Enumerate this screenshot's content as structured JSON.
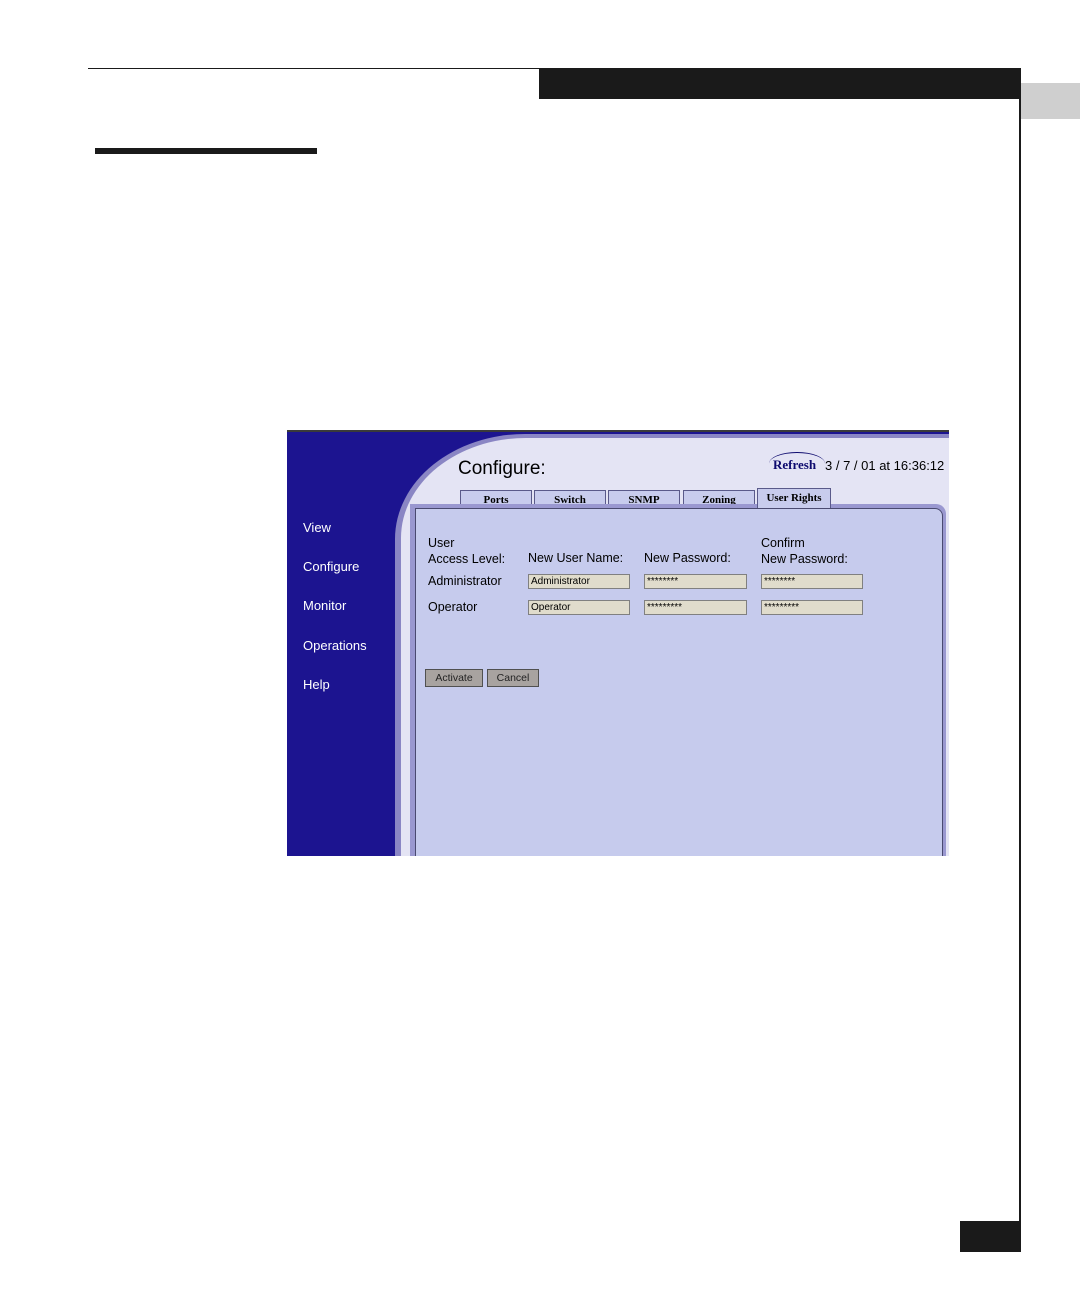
{
  "app": {
    "title": "Configure:",
    "refresh_label": "Refresh",
    "timestamp": "3 / 7 / 01 at 16:36:12"
  },
  "nav": {
    "items": [
      {
        "label": "View"
      },
      {
        "label": "Configure"
      },
      {
        "label": "Monitor"
      },
      {
        "label": "Operations"
      },
      {
        "label": "Help"
      }
    ]
  },
  "tabs": [
    {
      "label": "Ports"
    },
    {
      "label": "Switch"
    },
    {
      "label": "SNMP"
    },
    {
      "label": "Zoning"
    },
    {
      "label": "User Rights",
      "active": true
    }
  ],
  "form": {
    "headers": {
      "access_level": "User\nAccess Level:",
      "new_user_name": "New User Name:",
      "new_password": "New Password:",
      "confirm_password": "Confirm\nNew Password:"
    },
    "rows": [
      {
        "level": "Administrator",
        "user_name": "Administrator",
        "password": "********",
        "confirm": "********"
      },
      {
        "level": "Operator",
        "user_name": "Operator",
        "password": "*********",
        "confirm": "*********"
      }
    ],
    "activate_label": "Activate",
    "cancel_label": "Cancel"
  },
  "colors": {
    "sidebar": "#1c1490",
    "panel": "#c6cbed",
    "field": "#e0dccc"
  }
}
